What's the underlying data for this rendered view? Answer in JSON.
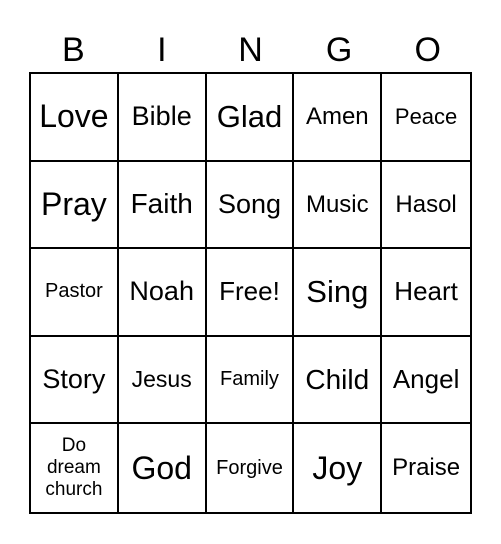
{
  "header": [
    "B",
    "I",
    "N",
    "G",
    "O"
  ],
  "cells": [
    [
      "Love",
      "Bible",
      "Glad",
      "Amen",
      "Peace"
    ],
    [
      "Pray",
      "Faith",
      "Song",
      "Music",
      "Hasol"
    ],
    [
      "Pastor",
      "Noah",
      "Free!",
      "Sing",
      "Heart"
    ],
    [
      "Story",
      "Jesus",
      "Family",
      "Child",
      "Angel"
    ],
    [
      "Do\ndream\nchurch",
      "God",
      "Forgive",
      "Joy",
      "Praise"
    ]
  ]
}
